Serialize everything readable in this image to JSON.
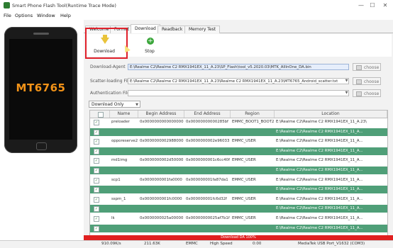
{
  "window": {
    "title": "Smart Phone Flash Tool(Runtime Trace Mode)",
    "minimize": "—",
    "maximize": "☐",
    "close": "✕"
  },
  "menu": [
    "File",
    "Options",
    "Window",
    "Help"
  ],
  "device": {
    "chip": "MT6765"
  },
  "tabs": [
    "Welcome",
    "Format",
    "Download",
    "Readback",
    "Memory Test"
  ],
  "active_tab": "Download",
  "toolbar": {
    "download_label": "Download",
    "stop_label": "Stop"
  },
  "fields": {
    "download_agent": {
      "label": "Download-Agent",
      "value": "E:\\Realme C2\\Realme C2 RMX1941EX_11_A.23\\SP_Flash\\tool_v5.2020.03\\MTK_AllInOne_DA.bin"
    },
    "scatter": {
      "label": "Scatter-loading File",
      "value": "E:\\Realme C2\\Realme C2 RMX1941EX_11_A.23\\Realme C2 RMX1941EX_11_A.23\\MT6765_Android_scatter.txt"
    },
    "auth": {
      "label": "Authentication File",
      "value": ""
    },
    "choose_label": "choose"
  },
  "mode_select": "Download Only",
  "table": {
    "headers": [
      "",
      "Name",
      "Begin Address",
      "End Address",
      "Region",
      "Location"
    ],
    "rows": [
      {
        "name": "preloader",
        "begin": "0x0000000000000000",
        "end": "0x00000000000285bf",
        "region": "EMMC_BOOT1_BOOT2",
        "location": "E:\\Realme C2\\Realme C2 RMX1941EX_11_A.23\\"
      },
      {
        "name": "",
        "begin": "",
        "end": "",
        "region": "",
        "location": "E:\\Realme C2\\Realme C2 RMX1941EX_11_A..."
      },
      {
        "name": "opporeserve2",
        "begin": "0x0000000002988000",
        "end": "0x0000000002e96033",
        "region": "EMMC_USER",
        "location": "E:\\Realme C2\\Realme C2 RMX1941EX_11_A..."
      },
      {
        "name": "",
        "begin": "",
        "end": "",
        "region": "",
        "location": "E:\\Realme C2\\Realme C2 RMX1941EX_11_A..."
      },
      {
        "name": "md1img",
        "begin": "0x0000000002d50000",
        "end": "0x0000000001c6cc40f",
        "region": "EMMC_USER",
        "location": "E:\\Realme C2\\Realme C2 RMX1941EX_11_A..."
      },
      {
        "name": "",
        "begin": "",
        "end": "",
        "region": "",
        "location": "E:\\Realme C2\\Realme C2 RMX1941EX_11_A..."
      },
      {
        "name": "scp1",
        "begin": "0x0000000001fa0000",
        "end": "0x000000001fa87da1",
        "region": "EMMC_USER",
        "location": "E:\\Realme C2\\Realme C2 RMX1941EX_11_A..."
      },
      {
        "name": "",
        "begin": "",
        "end": "",
        "region": "",
        "location": "E:\\Realme C2\\Realme C2 RMX1941EX_11_A..."
      },
      {
        "name": "sspm_1",
        "begin": "0x0000000001fc0000",
        "end": "0x000000001fc6d32f",
        "region": "EMMC_USER",
        "location": "E:\\Realme C2\\Realme C2 RMX1941EX_11_A..."
      },
      {
        "name": "",
        "begin": "",
        "end": "",
        "region": "",
        "location": "E:\\Realme C2\\Realme C2 RMX1941EX_11_A..."
      },
      {
        "name": "lk",
        "begin": "0x0000000025a00000",
        "end": "0x00000000025af7b1f",
        "region": "EMMC_USER",
        "location": "E:\\Realme C2\\Realme C2 RMX1941EX_11_A..."
      },
      {
        "name": "",
        "begin": "",
        "end": "",
        "region": "",
        "location": "E:\\Realme C2\\Realme C2 RMX1941EX_11_A..."
      }
    ]
  },
  "progress": {
    "text": "Download DA 100%",
    "percent": 100
  },
  "status": {
    "speed": "910.09K/s",
    "size": "211.63K",
    "storage": "EMMC",
    "mode": "High Speed",
    "time": "0:00",
    "port": "MediaTek USB Port_V1632 (COM3)"
  }
}
